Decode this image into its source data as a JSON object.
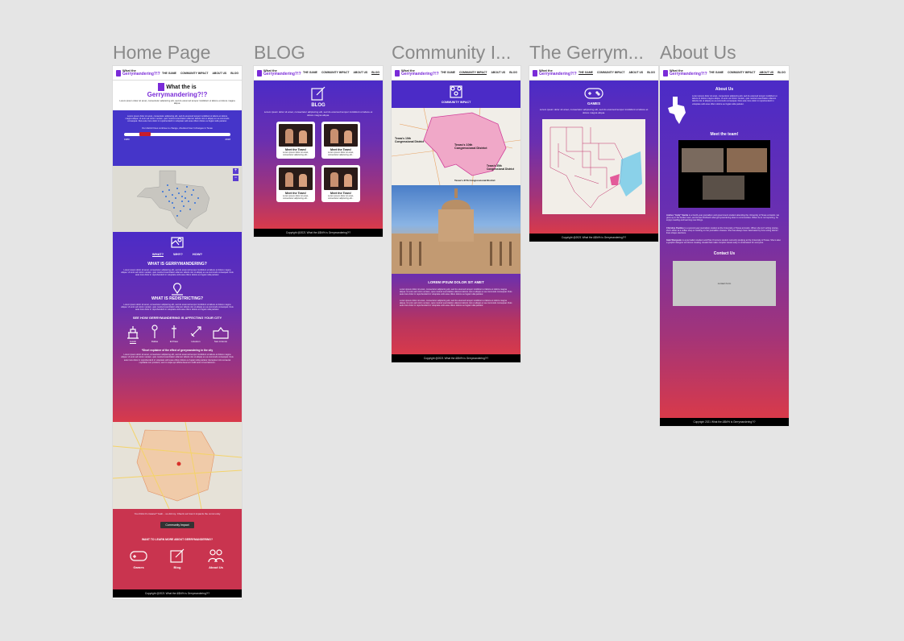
{
  "frames": {
    "home": "Home Page",
    "blog": "BLOG",
    "community": "Community I...",
    "gerry": "The Gerrym...",
    "about": "About Us"
  },
  "nav": {
    "logo_top": "What the",
    "logo_mid": "is",
    "logo_main": "Gerrymandering?!?",
    "links": [
      "THE GAME",
      "COMMUNITY IMPACT",
      "ABOUT US",
      "BLOG"
    ]
  },
  "home": {
    "hero_title_a": "What the",
    "hero_title_b": "is",
    "hero_title_c": "Gerrymandering?!?",
    "hero_sub": "Lorem ipsum dolor sit amet, consectetur adipiscing elit, sed do eiusmod tempor incididunt ut labore et dolore magna aliqua.",
    "intro_text": "Lorem ipsum dolor sit amet, consectetur adipiscing elit, sed do eiusmod tempor incididunt ut labore et dolore magna aliqua. Ut enim ad minim veniam, quis nostrud exercitation ullamco laboris nisi ut aliquip ex ea commodo consequat. Duis aute irure dolor in reprehenderit in voluptate velit esse cillum dolore eu fugiat nulla pariatur.",
    "slider_caption": "Our district lines continue to change, checkout how it changes in Texas",
    "slider_start": "1980",
    "slider_end": "2018",
    "slider_value": 0.2,
    "tabs": [
      "WHAT?",
      "WHY?",
      "HOW?"
    ],
    "what_title": "WHAT IS GERRYMANDERING?",
    "what_text": "Lorem ipsum dolor sit amet, consectetur adipiscing elit, sed do eiusmod tempor incididunt ut labore et dolore magna aliqua. Ut enim ad minim veniam, quis nostrud exercitation ullamco laboris nisi ut aliquip ex ea commodo consequat. Duis aute irure dolor in reprehenderit in voluptate velit esse cillum dolore eu fugiat nulla pariatur.",
    "redistrict_title": "WHAT IS REDISTRICTING?",
    "redistrict_text": "Lorem ipsum dolor sit amet, consectetur adipiscing elit, sed do eiusmod tempor incididunt ut labore et dolore magna aliqua. Ut enim ad minim veniam, quis nostrud exercitation ullamco laboris nisi ut aliquip ex ea commodo consequat. Duis aute irure dolor in reprehenderit in voluptate velit esse cillum dolore eu fugiat nulla pariatur.",
    "city_title": "SEE HOW GERRYMANDERING IS AFFECTING YOUR CITY",
    "cities": [
      "Austin",
      "Dallas",
      "El Paso",
      "Houston",
      "San Antonio"
    ],
    "city_caption": "*Short explainer of the effect of gerrymandering in the city",
    "city_text": "Lorem ipsum dolor sit amet, consectetur adipiscing elit, sed do eiusmod tempor incididunt ut labore et dolore magna aliqua. Ut enim ad minim veniam, quis nostrud exercitation ullamco laboris nisi ut aliquip ex ea commodo consequat. Duis aute irure dolor in reprehenderit in voluptate velit esse cillum dolore eu fugiat nulla pariatur. Excepteur sint occaecat cupidatat non proident, sunt in culpa qui officia deserunt mollit anim id est laborum.",
    "impact_text": "You think it's insane? Yeah... so did my. Check out how it impacts the community",
    "impact_button": "Community Impact",
    "learn_title": "WANT TO LEARN MORE ABOUT GERRYMANDERING?",
    "learn_links": [
      "Games",
      "Blog",
      "About Us"
    ],
    "footer": "Copyright @2021 What the &$!#% is Gerrymandering?!?"
  },
  "blog": {
    "title": "BLOG",
    "intro": "Lorem ipsum dolor sit amet, consectetur adipiscing elit, sed do eiusmod tempor incididunt ut labore et dolore magna aliqua.",
    "cards": [
      {
        "title": "Meet the Team!",
        "desc": "Lorem ipsum dolor sit amet, consectetur adipiscing elit..."
      },
      {
        "title": "Meet the Team!",
        "desc": "Lorem ipsum dolor sit amet, consectetur adipiscing elit..."
      },
      {
        "title": "Meet the Team!",
        "desc": "Lorem ipsum dolor sit amet, consectetur adipiscing elit..."
      },
      {
        "title": "Meet the Team!",
        "desc": "Lorem ipsum dolor sit amet, consectetur adipiscing elit..."
      }
    ],
    "footer": "Copyright @2021 What the &$!#% is Gerrymandering?!?"
  },
  "community": {
    "header": "COMMUNITY IMPACT",
    "map_label_1": "Texas's 10th Congressional District",
    "map_label_2": "Texas's 10th Congressional District",
    "map_label_3": "Texas's 35th Congressional District",
    "map_label_4": "Texas's 37th Congressional District",
    "section_title": "LOREM IPSUM DOLOR SIT AMET",
    "text_1": "Lorem ipsum dolor sit amet, consectetur adipiscing elit, sed do eiusmod tempor incididunt ut labore et dolore magna aliqua. Ut enim ad minim veniam, quis nostrud exercitation ullamco laboris nisi ut aliquip ex ea commodo consequat. Duis aute irure dolor in reprehenderit in voluptate velit esse cillum dolore eu fugiat nulla pariatur.",
    "text_2": "Lorem ipsum dolor sit amet, consectetur adipiscing elit, sed do eiusmod tempor incididunt ut labore et dolore magna aliqua. Ut enim ad minim veniam, quis nostrud exercitation ullamco laboris nisi ut aliquip ex ea commodo consequat. Duis aute irure dolor in reprehenderit in voluptate velit esse cillum dolore eu fugiat nulla pariatur.",
    "footer": "Copyright @2021 What the &$!#% is Gerrymandering?!?"
  },
  "gerry": {
    "title": "GAMES",
    "intro": "Lorem ipsum dolor sit amet, consectetur adipiscing elit, sed do eiusmod tempor incididunt ut labore et dolore magna aliqua.",
    "footer": "Copyright @2021 What the &$!#% is Gerrymandering?!?"
  },
  "about": {
    "title": "About Us",
    "intro": "Lorem ipsum dolor sit amet, consectetur adipiscing elit, sed do eiusmod tempor incididunt ut labore et dolore magna aliqua. Ut enim ad minim veniam, quis nostrud exercitation ullamco laboris nisi ut aliquip ex ea commodo consequat. Duis aute irure dolor in reprehenderit in voluptate velit esse cillum dolore eu fugiat nulla pariatur.",
    "team_title": "Meet the team!",
    "bios": [
      {
        "name": "Andres \"Andy\" Santia",
        "text": "is a fourth-year journalism and government student attending the University of Texas at Austin. He grew up in the border town, and knows firsthand what gerrymandering does to communities. When he is not reporting, he enjoys reading and learning new things."
      },
      {
        "name": "Christine Peebles",
        "text": "is a second-year journalism student at the University of Texas at Austin. When she isn't writing stories, she's either at a coffee shop or working on her journalism classes. She has always been fascinated by how voting district lines shape elections."
      },
      {
        "name": "Gabi Wongsuto",
        "text": "is a journalism student and Plan II Honors student currently studying at the University of Texas. She is also a graphic designer and loves creating visuals that make complex issues easy to understand for everyone."
      }
    ],
    "contact_title": "Contact Us",
    "contact_form": "contact form",
    "footer": "Copyright 2021 What the &$!#% is Gerrymandering?!?"
  }
}
